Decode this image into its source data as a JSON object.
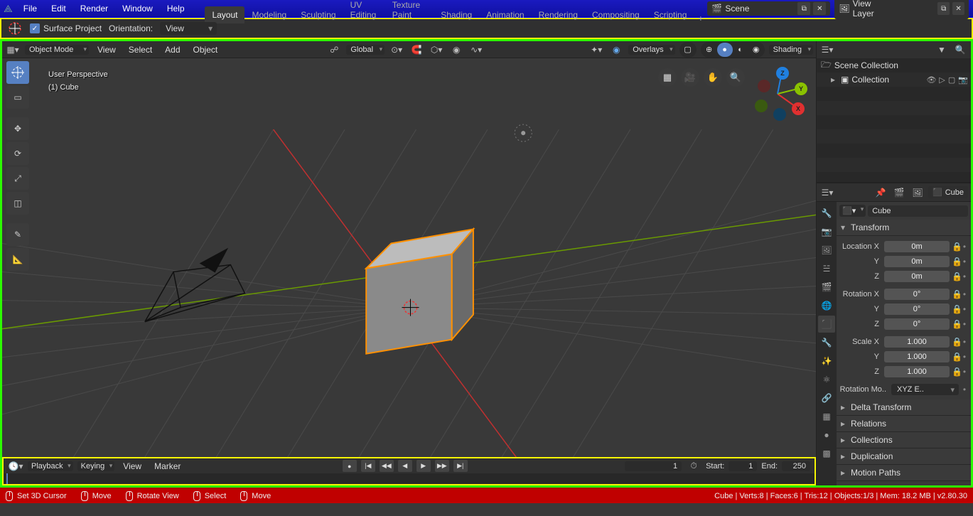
{
  "topmenu": {
    "file": "File",
    "edit": "Edit",
    "render": "Render",
    "window": "Window",
    "help": "Help"
  },
  "workspaces": [
    "Layout",
    "Modeling",
    "Sculpting",
    "UV Editing",
    "Texture Paint",
    "Shading",
    "Animation",
    "Rendering",
    "Compositing",
    "Scripting"
  ],
  "active_workspace": "Layout",
  "scene_name": "Scene",
  "view_layer": "View Layer",
  "toolsettings": {
    "surface_project": "Surface Project",
    "orientation_label": "Orientation:",
    "orientation_value": "View"
  },
  "viewport": {
    "mode": "Object Mode",
    "menus": [
      "View",
      "Select",
      "Add",
      "Object"
    ],
    "orient": "Global",
    "overlays": "Overlays",
    "shading": "Shading",
    "info_line1": "User Perspective",
    "info_line2": "(1)  Cube"
  },
  "timeline": {
    "playback": "Playback",
    "keying": "Keying",
    "view": "View",
    "marker": "Marker",
    "current": 1,
    "start_label": "Start:",
    "start": 1,
    "end_label": "End:",
    "end": 250
  },
  "outliner": {
    "scene_collection": "Scene Collection",
    "collection": "Collection"
  },
  "properties": {
    "object_name": "Cube",
    "object_name2": "Cube",
    "panels": {
      "transform": "Transform",
      "delta": "Delta Transform",
      "relations": "Relations",
      "collections": "Collections",
      "duplication": "Duplication",
      "motion": "Motion Paths"
    },
    "transform": {
      "loc_label": "Location X",
      "loc_y": "Y",
      "loc_z": "Z",
      "rot_label": "Rotation X",
      "rot_y": "Y",
      "rot_z": "Z",
      "scl_label": "Scale X",
      "scl_y": "Y",
      "scl_z": "Z",
      "loc": {
        "x": "0m",
        "y": "0m",
        "z": "0m"
      },
      "rot": {
        "x": "0°",
        "y": "0°",
        "z": "0°"
      },
      "scl": {
        "x": "1.000",
        "y": "1.000",
        "z": "1.000"
      },
      "rotmode_label": "Rotation Mo..",
      "rotmode": "XYZ E.."
    }
  },
  "statusbar": {
    "set3dcursor": "Set 3D Cursor",
    "move1": "Move",
    "rotate": "Rotate View",
    "select": "Select",
    "move2": "Move",
    "info": "Cube | Verts:8 | Faces:6 | Tris:12 | Objects:1/3 | Mem: 18.2 MB | v2.80.30"
  }
}
